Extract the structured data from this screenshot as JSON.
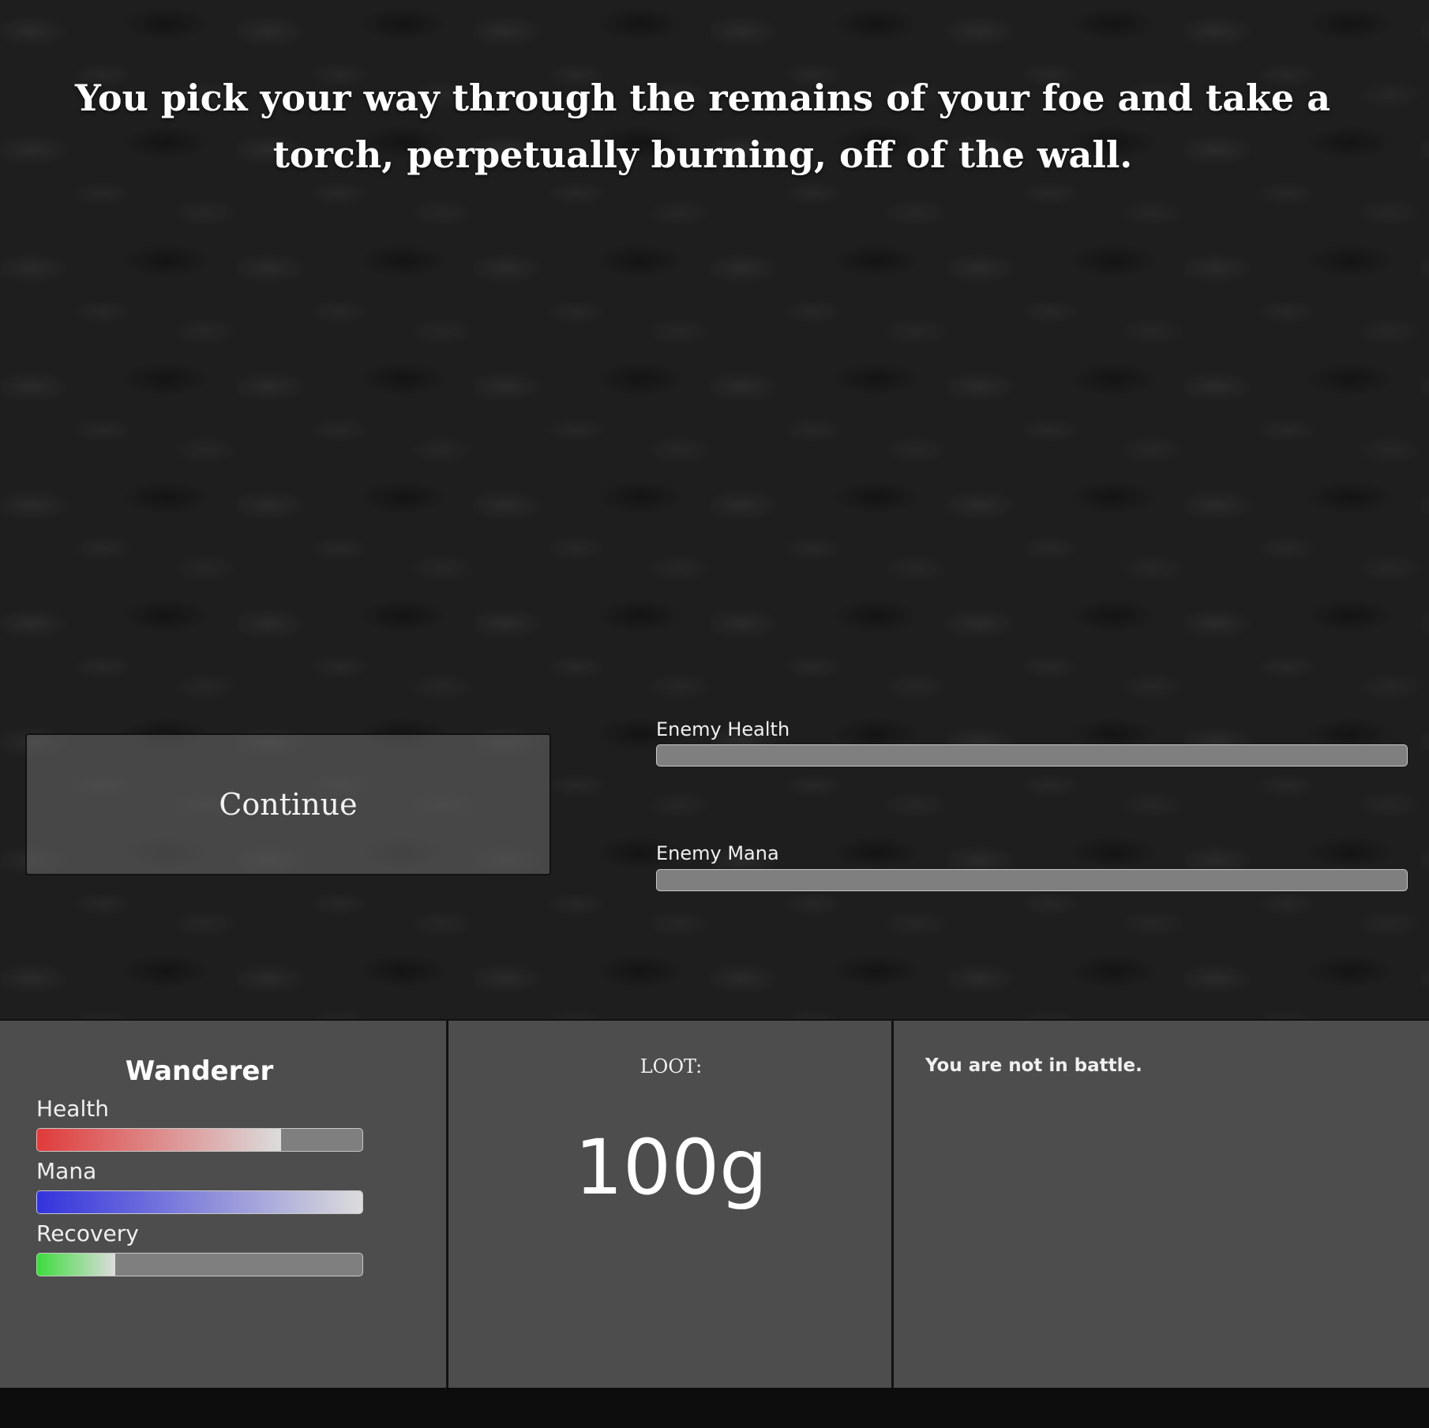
{
  "story": {
    "text": "You pick your way through the remains of your foe and take a torch, perpetually burning, off of the wall."
  },
  "actions": {
    "continue_label": "Continue"
  },
  "enemy": {
    "health_label": "Enemy Health",
    "health_fill": 0,
    "mana_label": "Enemy Mana",
    "mana_fill": 0
  },
  "character": {
    "name": "Wanderer",
    "health_label": "Health",
    "health_fill": 0.75,
    "health_color": "#e03b3b",
    "mana_label": "Mana",
    "mana_fill": 1.0,
    "mana_color": "#3333dd",
    "recovery_label": "Recovery",
    "recovery_fill": 0.24,
    "recovery_color": "#3ddc3d"
  },
  "loot": {
    "label": "LOOT:",
    "value": "100g"
  },
  "battle": {
    "status": "You are not in battle."
  }
}
